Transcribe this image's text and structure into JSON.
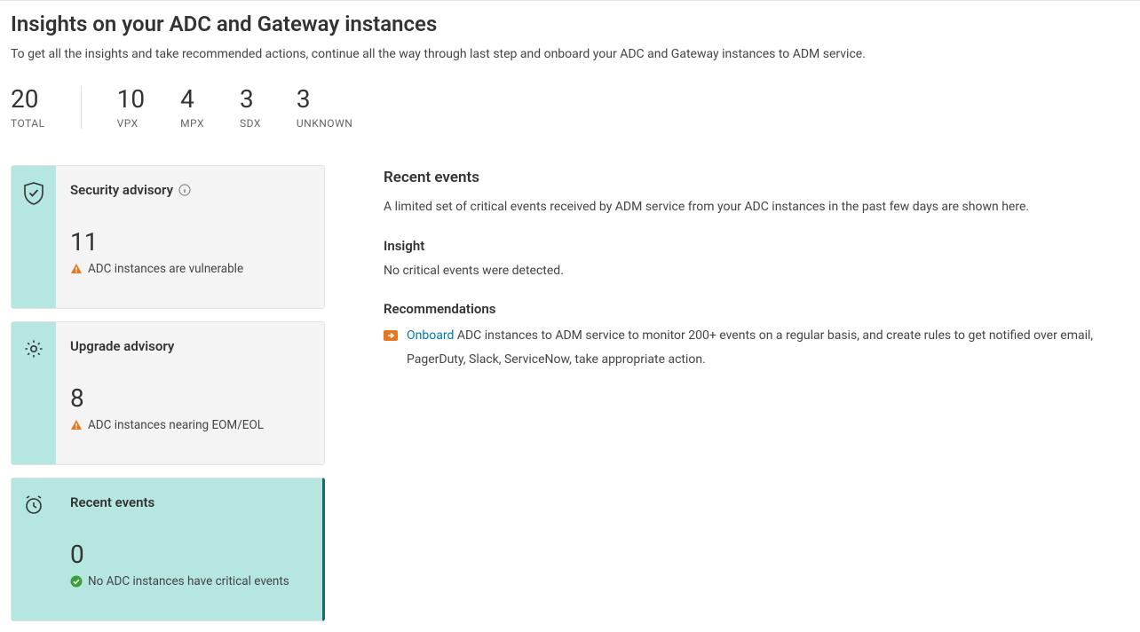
{
  "header": {
    "title": "Insights on your ADC and Gateway instances",
    "subtitle": "To get all the insights and take recommended actions, continue all the way through last step and onboard your ADC and Gateway instances to ADM service."
  },
  "stats": [
    {
      "value": "20",
      "label": "TOTAL"
    },
    {
      "value": "10",
      "label": "VPX"
    },
    {
      "value": "4",
      "label": "MPX"
    },
    {
      "value": "3",
      "label": "SDX"
    },
    {
      "value": "3",
      "label": "UNKNOWN"
    }
  ],
  "cards": [
    {
      "title": "Security advisory",
      "has_info": true,
      "value": "11",
      "status_icon": "warn",
      "status_text": "ADC instances are vulnerable",
      "selected": false
    },
    {
      "title": "Upgrade advisory",
      "has_info": false,
      "value": "8",
      "status_icon": "warn",
      "status_text": "ADC instances nearing EOM/EOL",
      "selected": false
    },
    {
      "title": "Recent events",
      "has_info": false,
      "value": "0",
      "status_icon": "ok",
      "status_text": "No ADC instances have critical events",
      "selected": true
    }
  ],
  "detail": {
    "heading": "Recent events",
    "description": "A limited set of critical events received by ADM service from your ADC instances in the past few days are shown here.",
    "insight_heading": "Insight",
    "insight_text": "No critical events were detected.",
    "recs_heading": "Recommendations",
    "rec_link": "Onboard",
    "rec_text_after": " ADC instances to ADM service to monitor 200+ events on a regular basis, and create rules to get notified over email, PagerDuty, Slack, ServiceNow, take appropriate action."
  }
}
